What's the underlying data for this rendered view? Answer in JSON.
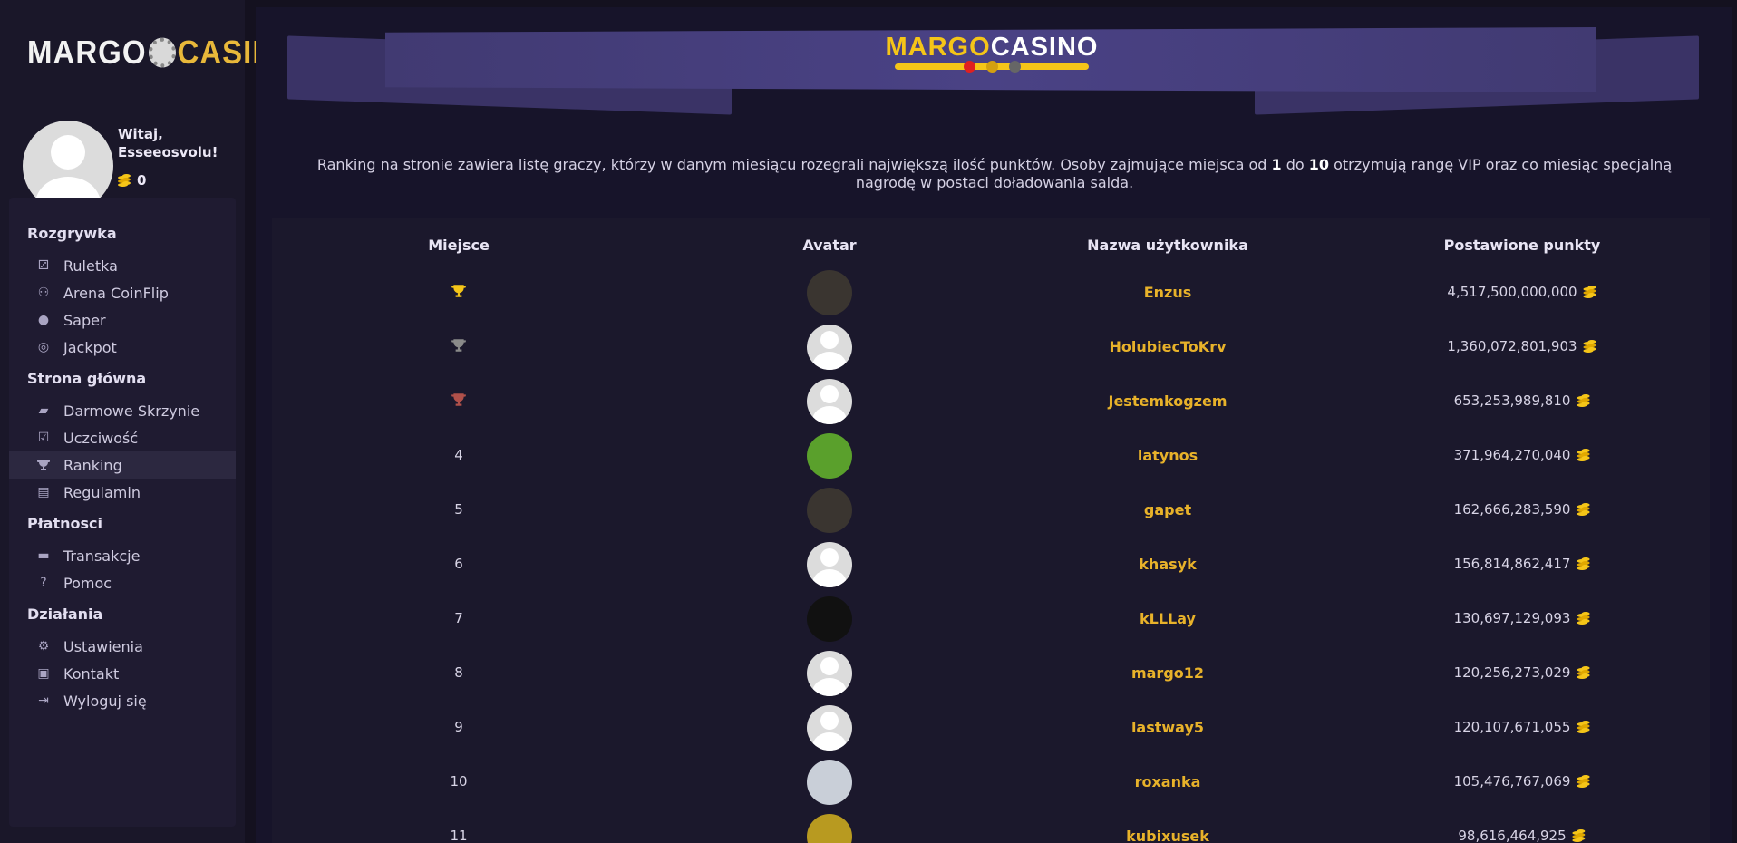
{
  "brand": {
    "part1": "MARGO",
    "part2": "CASINO"
  },
  "user": {
    "greeting": "Witaj, Esseeosvolu!",
    "balance": "0"
  },
  "nav": {
    "sections": [
      {
        "title": "Rozgrywka",
        "items": [
          {
            "label": "Ruletka",
            "icon": "dice-icon"
          },
          {
            "label": "Arena CoinFlip",
            "icon": "users-icon"
          },
          {
            "label": "Saper",
            "icon": "bomb-icon"
          },
          {
            "label": "Jackpot",
            "icon": "target-icon"
          }
        ]
      },
      {
        "title": "Strona główna",
        "items": [
          {
            "label": "Darmowe Skrzynie",
            "icon": "briefcase-icon"
          },
          {
            "label": "Uczciwość",
            "icon": "clipboard-check-icon"
          },
          {
            "label": "Ranking",
            "icon": "trophy-icon",
            "active": true
          },
          {
            "label": "Regulamin",
            "icon": "book-icon"
          }
        ]
      },
      {
        "title": "Płatnosci",
        "items": [
          {
            "label": "Transakcje",
            "icon": "wallet-icon"
          },
          {
            "label": "Pomoc",
            "icon": "question-circle-icon"
          }
        ]
      },
      {
        "title": "Działania",
        "items": [
          {
            "label": "Ustawienia",
            "icon": "user-cog-icon"
          },
          {
            "label": "Kontakt",
            "icon": "address-book-icon"
          },
          {
            "label": "Wyloguj się",
            "icon": "sign-out-icon"
          }
        ]
      }
    ]
  },
  "intro": {
    "before": "Ranking na stronie zawiera listę graczy, którzy w danym miesiącu rozegrali największą ilość punktów. Osoby zajmujące miejsca od ",
    "from": "1",
    "mid": " do ",
    "to": "10",
    "after": " otrzymują rangę VIP oraz co miesiąc specjalną nagrodę w postaci doładowania salda."
  },
  "table": {
    "headers": {
      "place": "Miejsce",
      "avatar": "Avatar",
      "username": "Nazwa użytkownika",
      "points": "Postawione punkty"
    },
    "rows": [
      {
        "place": "",
        "trophy": "gold",
        "name": "Enzus",
        "points": "4,517,500,000,000",
        "avatar": "photo"
      },
      {
        "place": "",
        "trophy": "silver",
        "name": "HolubiecToKrv",
        "points": "1,360,072,801,903",
        "avatar": "default"
      },
      {
        "place": "",
        "trophy": "bronze",
        "name": "Jestemkogzem",
        "points": "653,253,989,810",
        "avatar": "default"
      },
      {
        "place": "4",
        "trophy": "",
        "name": "latynos",
        "points": "371,964,270,040",
        "avatar": "green"
      },
      {
        "place": "5",
        "trophy": "",
        "name": "gapet",
        "points": "162,666,283,590",
        "avatar": "photo"
      },
      {
        "place": "6",
        "trophy": "",
        "name": "khasyk",
        "points": "156,814,862,417",
        "avatar": "default"
      },
      {
        "place": "7",
        "trophy": "",
        "name": "kLLLay",
        "points": "130,697,129,093",
        "avatar": "anime"
      },
      {
        "place": "8",
        "trophy": "",
        "name": "margo12",
        "points": "120,256,273,029",
        "avatar": "default"
      },
      {
        "place": "9",
        "trophy": "",
        "name": "lastway5",
        "points": "120,107,671,055",
        "avatar": "default"
      },
      {
        "place": "10",
        "trophy": "",
        "name": "roxanka",
        "points": "105,476,767,069",
        "avatar": "photo-light"
      },
      {
        "place": "11",
        "trophy": "",
        "name": "kubixusek",
        "points": "98,616,464,925",
        "avatar": "yellow"
      }
    ]
  },
  "colors": {
    "accent": "#e8b22a",
    "gold": "#f5c518",
    "silver": "#8a8a8a",
    "bronze": "#b0504a",
    "banner": "#3a3366"
  }
}
